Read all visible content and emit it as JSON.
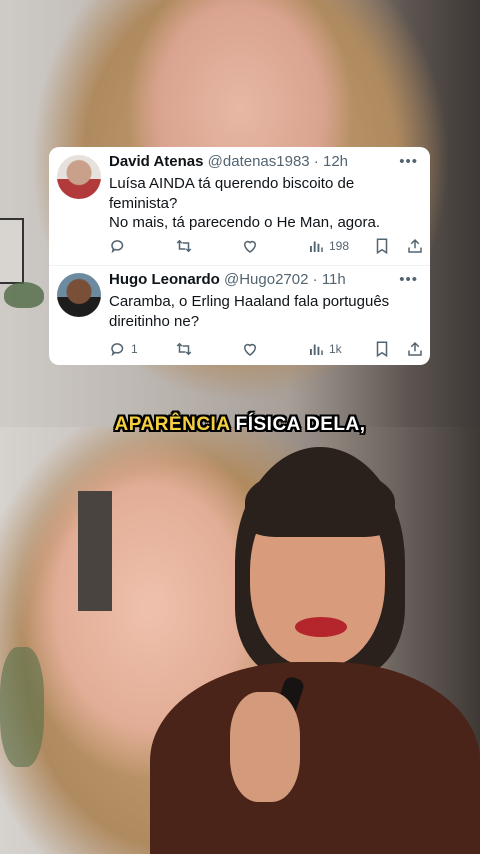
{
  "tweets": [
    {
      "name": "David Atenas",
      "handle": "@datenas1983",
      "time": "12h",
      "lines": [
        "Luísa AINDA tá querendo biscoito de",
        "feminista?",
        "No mais, tá parecendo o He Man, agora."
      ],
      "reply_count": "",
      "views": "198"
    },
    {
      "name": "Hugo Leonardo",
      "handle": "@Hugo2702",
      "time": "11h",
      "lines": [
        "Caramba, o Erling Haaland fala português",
        "direitinho ne?"
      ],
      "reply_count": "1",
      "views": "1k"
    }
  ],
  "more_glyph": "•••",
  "caption": {
    "highlight": "APARÊNCIA",
    "rest": "FÍSICA DELA,"
  },
  "icons": [
    "reply-icon",
    "retweet-icon",
    "like-icon",
    "views-icon",
    "bookmark-icon",
    "share-icon"
  ],
  "colors": {
    "caption_highlight": "#f4d03f",
    "secondary_text": "#536471",
    "primary_text": "#0f1419"
  }
}
